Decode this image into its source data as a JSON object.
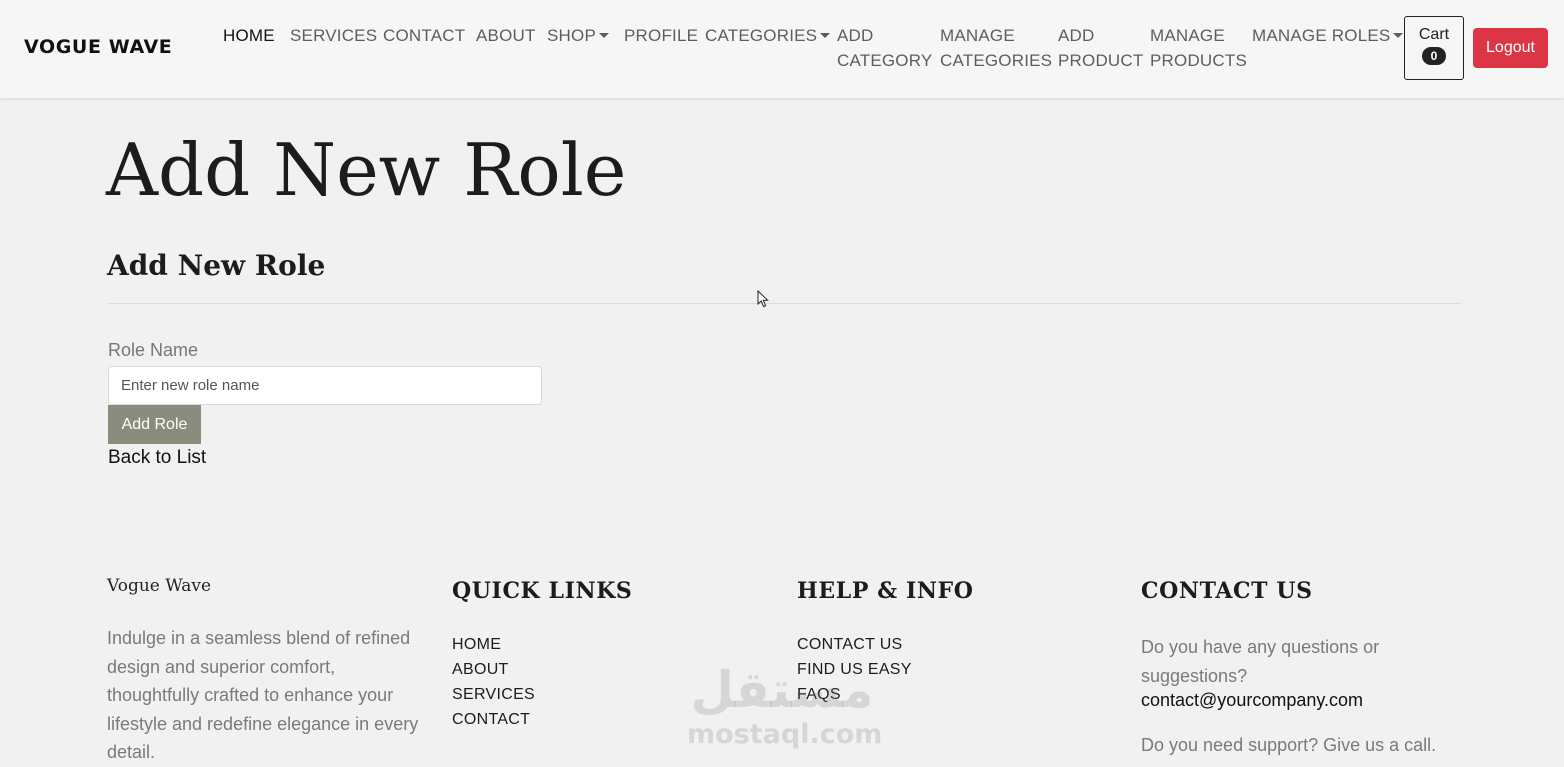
{
  "navbar": {
    "brand": "VOGUE WAVE",
    "items": [
      {
        "label": "HOME",
        "active": true
      },
      {
        "label": "SERVICES"
      },
      {
        "label": "CONTACT"
      },
      {
        "label": "ABOUT"
      },
      {
        "label": "SHOP",
        "dropdown": true
      },
      {
        "label": "PROFILE"
      },
      {
        "label": "CATEGORIES",
        "dropdown": true
      },
      {
        "label_line1": "ADD",
        "label_line2": "CATEGORY"
      },
      {
        "label_line1": "MANAGE",
        "label_line2": "CATEGORIES"
      },
      {
        "label_line1": "ADD",
        "label_line2": "PRODUCT"
      },
      {
        "label_line1": "MANAGE",
        "label_line2": "PRODUCTS"
      },
      {
        "label": "MANAGE ROLES",
        "dropdown": true
      }
    ],
    "cart": {
      "label": "Cart",
      "count": "0"
    },
    "logout_label": "Logout"
  },
  "main": {
    "page_title": "Add New Role",
    "section_title": "Add New Role",
    "form": {
      "role_name_label": "Role Name",
      "role_name_placeholder": "Enter new role name",
      "role_name_value": "",
      "submit_label": "Add Role"
    },
    "back_link": "Back to List"
  },
  "footer": {
    "brand": "Vogue Wave",
    "description": "Indulge in a seamless blend of refined design and superior comfort, thoughtfully crafted to enhance your lifestyle and redefine elegance in every detail.",
    "quick_links": {
      "heading": "QUICK LINKS",
      "items": [
        "HOME",
        "ABOUT",
        "SERVICES",
        "CONTACT"
      ]
    },
    "help_info": {
      "heading": "HELP & INFO",
      "items": [
        "CONTACT US",
        "FIND US EASY",
        "FAQS"
      ]
    },
    "contact_us": {
      "heading": "CONTACT US",
      "question": "Do you have any questions or suggestions?",
      "email": "contact@yourcompany.com",
      "support": "Do you need support? Give us a call."
    }
  },
  "watermark": {
    "arabic": "مستقل",
    "latin": "mostaql.com"
  },
  "colors": {
    "background": "#f1f1f1",
    "logout": "#dc3545",
    "add_button": "#8b8c7d",
    "muted_text": "#7a7a7a"
  },
  "icons": {
    "dropdown": "caret-down-icon",
    "cursor": "mouse-pointer-icon"
  }
}
